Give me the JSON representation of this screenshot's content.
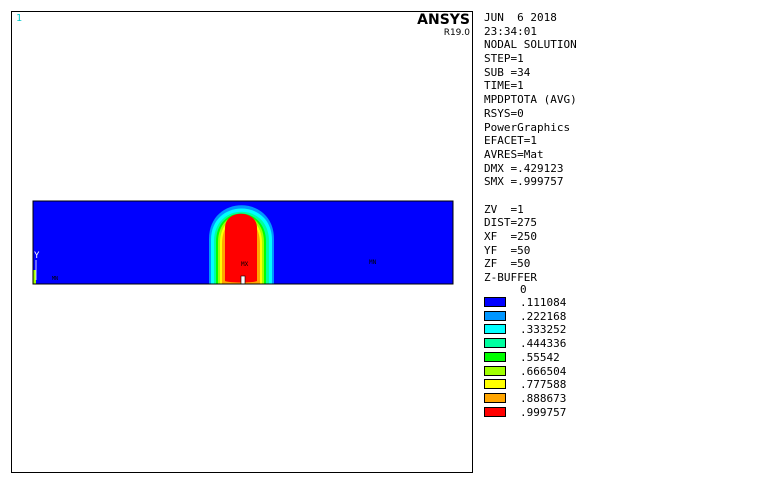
{
  "window": {
    "number": "1",
    "brand": "ANSYS",
    "release": "R19.0"
  },
  "info_lines": [
    "JUN  6 2018",
    "23:34:01",
    "NODAL SOLUTION",
    "STEP=1",
    "SUB =34",
    "TIME=1",
    "MPDPTOTA (AVG)",
    "RSYS=0",
    "PowerGraphics",
    "EFACET=1",
    "AVRES=Mat",
    "DMX =.429123",
    "SMX =.999757",
    "",
    "ZV  =1",
    "DIST=275",
    "XF  =250",
    "YF  =50",
    "ZF  =50",
    "Z-BUFFER"
  ],
  "legend": {
    "zero": "0",
    "items": [
      {
        "value": ".111084",
        "color": "#0000ff"
      },
      {
        "value": ".222168",
        "color": "#0096ff"
      },
      {
        "value": ".333252",
        "color": "#00ffff"
      },
      {
        "value": ".444336",
        "color": "#00ffa0"
      },
      {
        "value": ".55542",
        "color": "#00ff00"
      },
      {
        "value": ".666504",
        "color": "#a0ff00"
      },
      {
        "value": ".777588",
        "color": "#ffff00"
      },
      {
        "value": ".888673",
        "color": "#ffa500"
      },
      {
        "value": ".999757",
        "color": "#ff0000"
      }
    ]
  },
  "model": {
    "axis_label": "Y",
    "min_marker": "MN",
    "max_marker": "MX",
    "secondary_marker": "MN"
  }
}
